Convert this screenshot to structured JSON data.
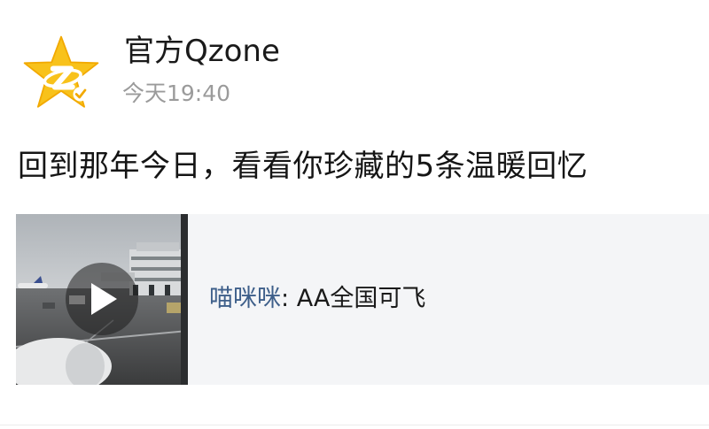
{
  "post": {
    "author": "官方Qzone",
    "time": "今天19:40",
    "text": "回到那年今日，看看你珍藏的5条温暖回忆",
    "avatar_icon": "qzone-star-logo-icon"
  },
  "shared_card": {
    "user": "喵咪咪",
    "separator": ": ",
    "message": "AA全国可飞",
    "thumbnail": "airport-tarmac-video-thumbnail",
    "play_icon": "play-icon"
  },
  "colors": {
    "star_yellow": "#f8c21b",
    "name_text": "#1a1a1a",
    "time_text": "#9b9b9b",
    "link_blue": "#3e5f8a",
    "card_bg": "#f4f5f7"
  }
}
